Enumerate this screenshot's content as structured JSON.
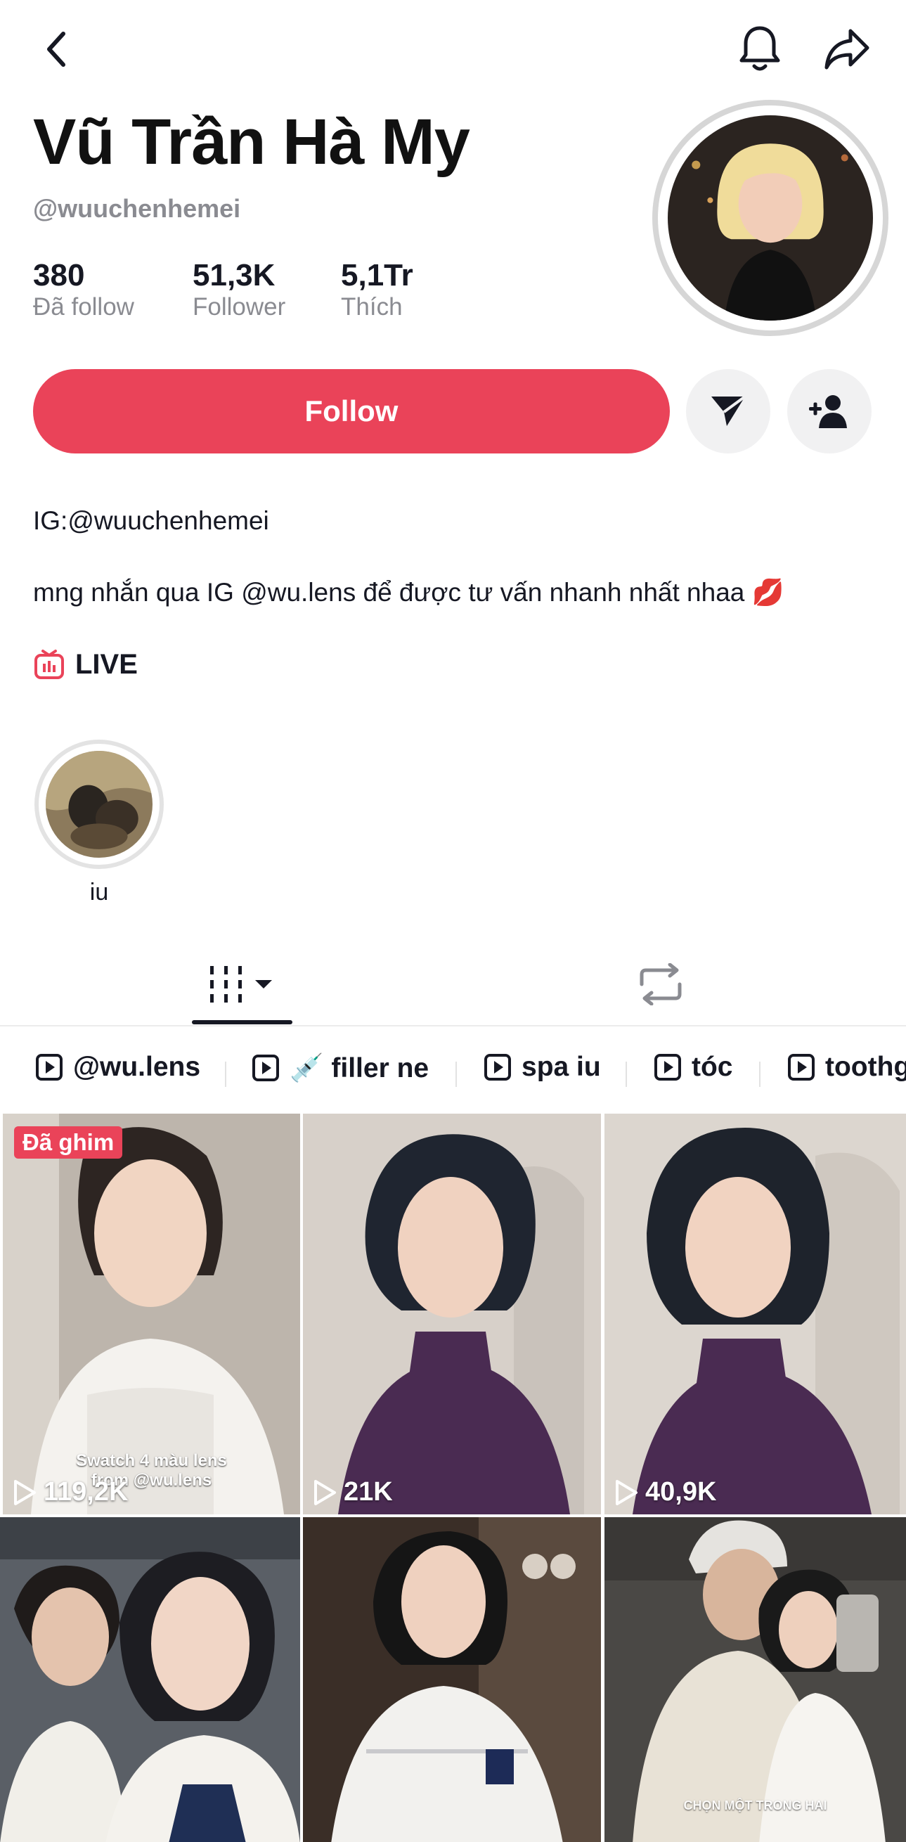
{
  "profile": {
    "name": "Vũ Trần Hà My",
    "handle": "@wuuchenhemei",
    "stats": [
      {
        "value": "380",
        "label": "Đã follow"
      },
      {
        "value": "51,3K",
        "label": "Follower"
      },
      {
        "value": "5,1Tr",
        "label": "Thích"
      }
    ]
  },
  "actions": {
    "follow_label": "Follow"
  },
  "bio": {
    "line1": "IG:@wuuchenhemei",
    "line2": "mng nhắn qua IG @wu.lens để được tư vấn nhanh nhất nhaa 💋",
    "live_label": "LIVE"
  },
  "highlights": [
    {
      "label": "iu"
    }
  ],
  "playlists": [
    {
      "label": "@wu.lens"
    },
    {
      "label": "💉 filler ne"
    },
    {
      "label": "spa iu"
    },
    {
      "label": "tóc"
    },
    {
      "label": "toothg"
    }
  ],
  "videos": [
    {
      "views": "119,2K",
      "pinned_label": "Đã ghim",
      "caption": "Swatch 4 màu lens\nfrom @wu.lens"
    },
    {
      "views": "21K"
    },
    {
      "views": "40,9K"
    },
    {
      "views": ""
    },
    {
      "views": ""
    },
    {
      "views": "",
      "caption": "CHỌN MỘT TRONG HAI"
    }
  ],
  "colors": {
    "accent": "#ea4359",
    "text_primary": "#161823",
    "text_secondary": "#8a8b91",
    "button_bg": "#f1f1f2"
  },
  "icons": {
    "back": "chevron-left-icon",
    "bell": "bell-icon",
    "share": "share-icon",
    "message": "send-icon",
    "add_friend": "add-user-icon",
    "live": "tv-icon",
    "videos_tab": "grid-icon",
    "reposts_tab": "repost-icon",
    "playlist": "play-square-icon",
    "views": "play-icon"
  }
}
